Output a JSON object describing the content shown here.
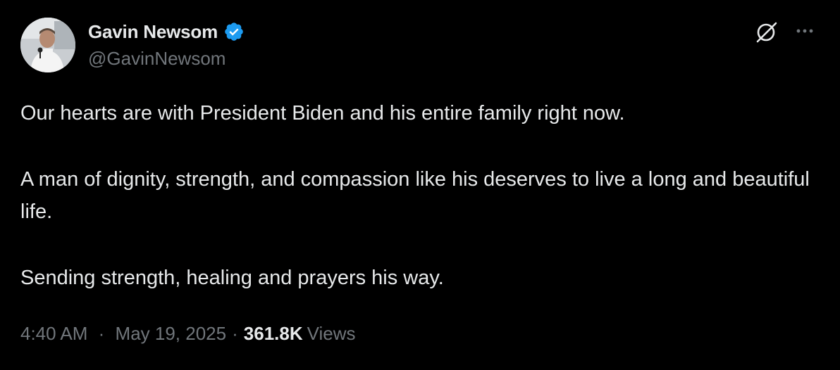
{
  "author": {
    "display_name": "Gavin Newsom",
    "handle": "@GavinNewsom",
    "verified_icon": "verified-badge-icon",
    "verified_color": "#1d9bf0"
  },
  "actions": {
    "grok_icon": "grok-icon",
    "more_icon": "more-icon"
  },
  "tweet": {
    "paragraphs": [
      "Our hearts are with President Biden and his entire family right now.",
      "A man of dignity, strength, and compassion like his deserves to live a long and beautiful life.",
      "Sending strength, healing and prayers his way."
    ]
  },
  "meta": {
    "time": "4:40 AM",
    "separator": "·",
    "date": "May 19, 2025",
    "views_count": "361.8K",
    "views_label": "Views"
  },
  "colors": {
    "background": "#000000",
    "primary_text": "#e7e9ea",
    "secondary_text": "#71767b",
    "accent": "#1d9bf0"
  }
}
